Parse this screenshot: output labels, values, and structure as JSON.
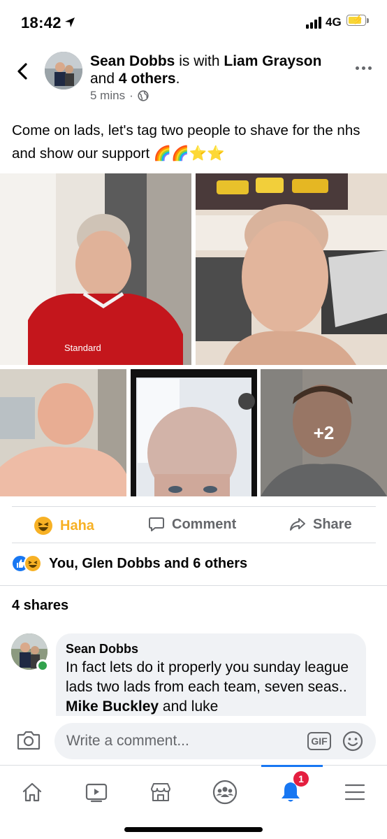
{
  "status_bar": {
    "time": "18:42",
    "network": "4G"
  },
  "post": {
    "author": "Sean Dobbs",
    "connector": " is with ",
    "tagged": "Liam Grayson",
    "and_text": "and ",
    "others": "4 others",
    "period": ".",
    "time_ago": "5 mins",
    "dot": "·",
    "text": "Come on lads, let's tag two people to shave for the nhs and show our support 🌈🌈⭐⭐",
    "more_photos": "+2"
  },
  "actions": {
    "haha": "Haha",
    "comment": "Comment",
    "share": "Share"
  },
  "reactions": {
    "summary": "You, Glen Dobbs and 6 others"
  },
  "shares": "4 shares",
  "comment": {
    "author": "Sean Dobbs",
    "text_prefix": "In fact lets do it properly you sunday league lads two lads from each team, seven seas.. ",
    "mention": "Mike Buckley",
    "text_suffix": " and luke"
  },
  "composer": {
    "placeholder": "Write a comment...",
    "gif": "GIF"
  },
  "tabbar": {
    "notifications_badge": "1"
  },
  "colors": {
    "accent": "#1877f2",
    "haha": "#f7b125",
    "badge": "#e41e3f",
    "online": "#31a24c"
  },
  "icons": [
    "back-arrow-icon",
    "globe-icon",
    "more-icon",
    "haha-icon",
    "comment-icon",
    "share-icon",
    "like-icon",
    "camera-icon",
    "gif-icon",
    "emoji-icon",
    "home-icon",
    "watch-icon",
    "marketplace-icon",
    "groups-icon",
    "bell-icon",
    "menu-icon"
  ]
}
